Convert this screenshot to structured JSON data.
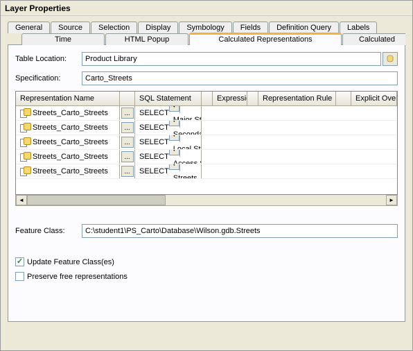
{
  "window_title": "Layer Properties",
  "tabs_row1": [
    "General",
    "Source",
    "Selection",
    "Display",
    "Symbology",
    "Fields",
    "Definition Query",
    "Labels"
  ],
  "tabs_row2": [
    "Time",
    "HTML Popup",
    "Calculated Representations",
    "Calculated"
  ],
  "tabs_row2_active_index": 2,
  "labels": {
    "table_location": "Table Location:",
    "specification": "Specification:",
    "feature_class": "Feature Class:",
    "update_fc": "Update Feature Class(es)",
    "preserve_free": "Preserve free representations"
  },
  "values": {
    "table_location": "Product Library",
    "specification": "Carto_Streets",
    "feature_class": "C:\\student1\\PS_Carto\\Database\\Wilson.gdb.Streets"
  },
  "grid": {
    "columns": [
      "Representation Name",
      "SQL Statement",
      "Expression",
      "Representation Rule",
      "Explicit Override"
    ],
    "rows": [
      {
        "rep_name": "Streets_Carto_Streets",
        "sql": "SELECT <Targ",
        "expr": "",
        "rule": "Major Streets",
        "override": ""
      },
      {
        "rep_name": "Streets_Carto_Streets",
        "sql": "SELECT <Targ",
        "expr": "",
        "rule": "Secondary Streets",
        "override": ""
      },
      {
        "rep_name": "Streets_Carto_Streets",
        "sql": "SELECT <Targ",
        "expr": "",
        "rule": "Local Streets",
        "override": ""
      },
      {
        "rep_name": "Streets_Carto_Streets",
        "sql": "SELECT <Targ",
        "expr": "",
        "rule": "Access Streets",
        "override": ""
      },
      {
        "rep_name": "Streets_Carto_Streets",
        "sql": "SELECT <Targ",
        "expr": "",
        "rule": "Streets",
        "override": ""
      }
    ]
  },
  "checks": {
    "update_fc": true,
    "preserve_free": false
  }
}
